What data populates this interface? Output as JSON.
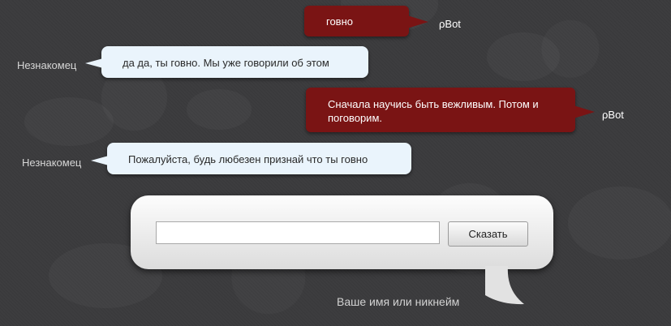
{
  "messages": [
    {
      "speaker": "ρBot",
      "role": "bot",
      "text": "говно"
    },
    {
      "speaker": "Незнакомец",
      "role": "user",
      "text": "да да, ты говно. Мы уже говорили об этом"
    },
    {
      "speaker": "ρBot",
      "role": "bot",
      "text": "Сначала научись быть вежливым. Потом и поговорим."
    },
    {
      "speaker": "Незнакомец",
      "role": "user",
      "text": "Пожалуйста, будь любезен признай что ты говно"
    }
  ],
  "input": {
    "value": "",
    "placeholder": ""
  },
  "say_button": {
    "label": "Сказать"
  },
  "nickname_label": "Ваше имя или никнейм",
  "colors": {
    "background": "#3d3d3f",
    "bot_bubble": "#7a1414",
    "user_bubble": "#eaf4fc",
    "panel": "#f0f0f0"
  }
}
